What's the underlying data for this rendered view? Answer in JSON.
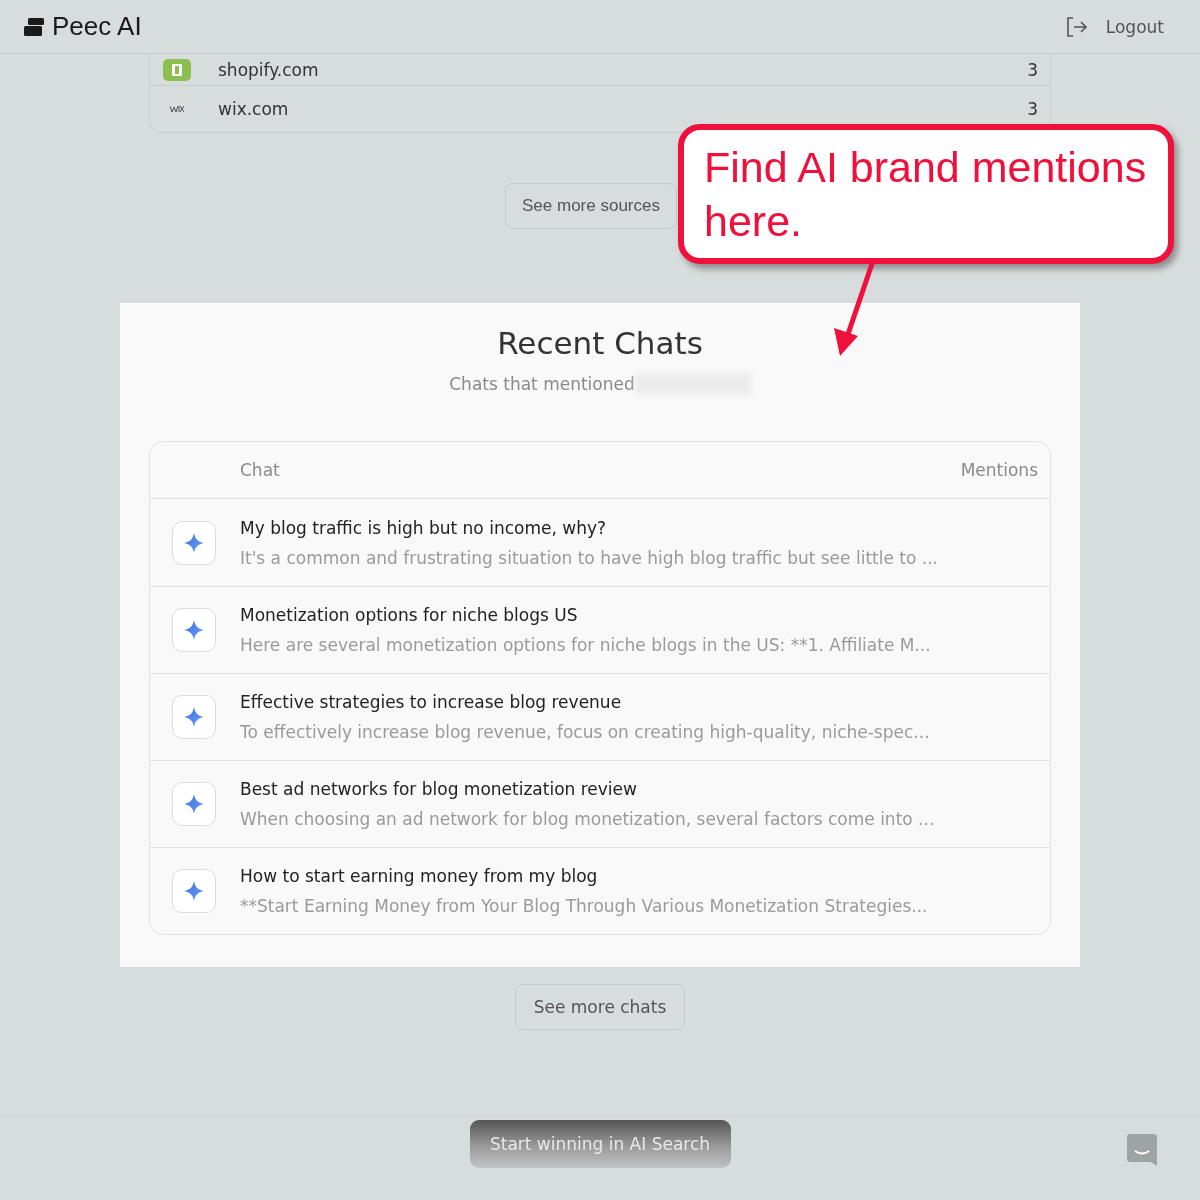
{
  "header": {
    "brand": "Peec AI",
    "logout": "Logout"
  },
  "sources": {
    "rows": [
      {
        "domain": "shopify.com",
        "count": "3",
        "kind": "shopify"
      },
      {
        "domain": "wix.com",
        "count": "3",
        "kind": "wix"
      }
    ],
    "more_button": "See more sources"
  },
  "callout": {
    "text": "Find AI brand mentions here."
  },
  "recent_chats": {
    "title": "Recent Chats",
    "subtitle": "Chats that mentioned",
    "columns": [
      "Chat",
      "Mentions"
    ],
    "rows": [
      {
        "title": "My blog traffic is high but no income, why?",
        "preview": "It's a common and frustrating situation to have high blog traffic but see little to ..."
      },
      {
        "title": "Monetization options for niche blogs US",
        "preview": "Here are several monetization options for niche blogs in the US: **1. Affiliate M..."
      },
      {
        "title": "Effective strategies to increase blog revenue",
        "preview": "To effectively increase blog revenue, focus on creating high-quality, niche-spec..."
      },
      {
        "title": "Best ad networks for blog monetization review",
        "preview": "When choosing an ad network for blog monetization, several factors come into ..."
      },
      {
        "title": "How to start earning money from my blog",
        "preview": "**Start Earning Money from Your Blog Through Various Monetization Strategies..."
      }
    ],
    "more_button": "See more chats"
  },
  "footer": {
    "cta": "Start winning in AI Search"
  }
}
